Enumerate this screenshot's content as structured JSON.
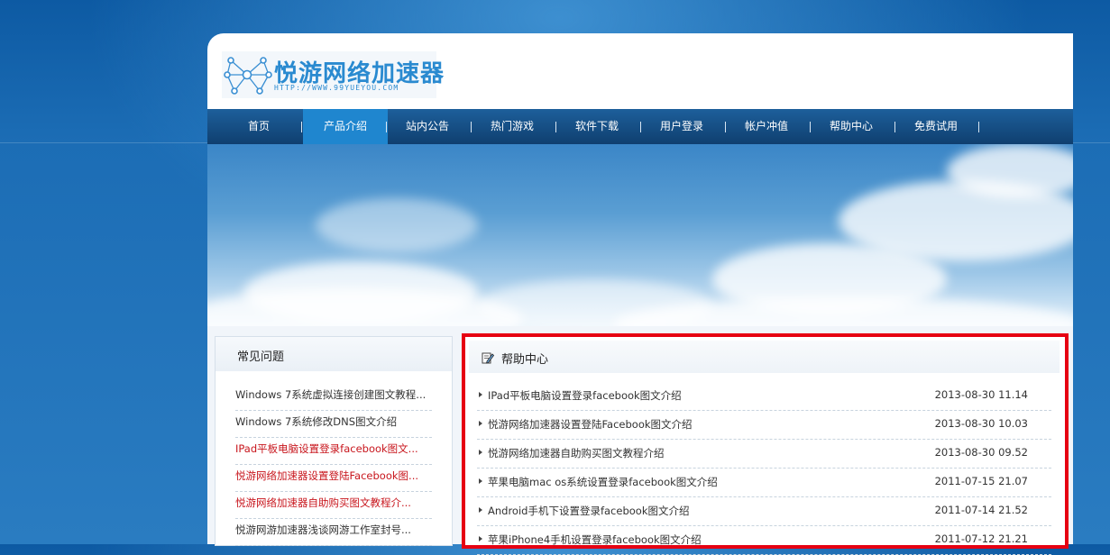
{
  "logo": {
    "name": "悦游网络加速器",
    "url": "HTTP://WWW.99YUEYOU.COM"
  },
  "nav": {
    "items": [
      {
        "label": "首页",
        "active": false
      },
      {
        "label": "产品介绍",
        "active": true
      },
      {
        "label": "站内公告",
        "active": false
      },
      {
        "label": "热门游戏",
        "active": false
      },
      {
        "label": "软件下载",
        "active": false
      },
      {
        "label": "用户登录",
        "active": false
      },
      {
        "label": "帐户冲值",
        "active": false
      },
      {
        "label": "帮助中心",
        "active": false
      },
      {
        "label": "免费试用",
        "active": false
      }
    ]
  },
  "faq": {
    "title": "常见问题",
    "items": [
      {
        "text": "Windows 7系统虚拟连接创建图文教程...",
        "highlight": false
      },
      {
        "text": "Windows 7系统修改DNS图文介绍",
        "highlight": false
      },
      {
        "text": "IPad平板电脑设置登录facebook图文...",
        "highlight": true
      },
      {
        "text": "悦游网络加速器设置登陆Facebook图...",
        "highlight": true
      },
      {
        "text": "悦游网络加速器自助购买图文教程介...",
        "highlight": true
      },
      {
        "text": "悦游网游加速器浅谈网游工作室封号...",
        "highlight": false
      }
    ]
  },
  "help": {
    "title": "帮助中心",
    "items": [
      {
        "text": "IPad平板电脑设置登录facebook图文介绍",
        "date": "2013-08-30 11.14"
      },
      {
        "text": "悦游网络加速器设置登陆Facebook图文介绍",
        "date": "2013-08-30 10.03"
      },
      {
        "text": "悦游网络加速器自助购买图文教程介绍",
        "date": "2013-08-30 09.52"
      },
      {
        "text": "苹果电脑mac os系统设置登录facebook图文介绍",
        "date": "2011-07-15 21.07"
      },
      {
        "text": "Android手机下设置登录facebook图文介绍",
        "date": "2011-07-14 21.52"
      },
      {
        "text": "苹果iPhone4手机设置登录facebook图文介绍",
        "date": "2011-07-12 21.21"
      }
    ]
  },
  "colors": {
    "accent": "#1f86cf",
    "nav_bg": "#0f3f6f",
    "highlight_text": "#c8161d",
    "annotation_border": "#e60012"
  }
}
